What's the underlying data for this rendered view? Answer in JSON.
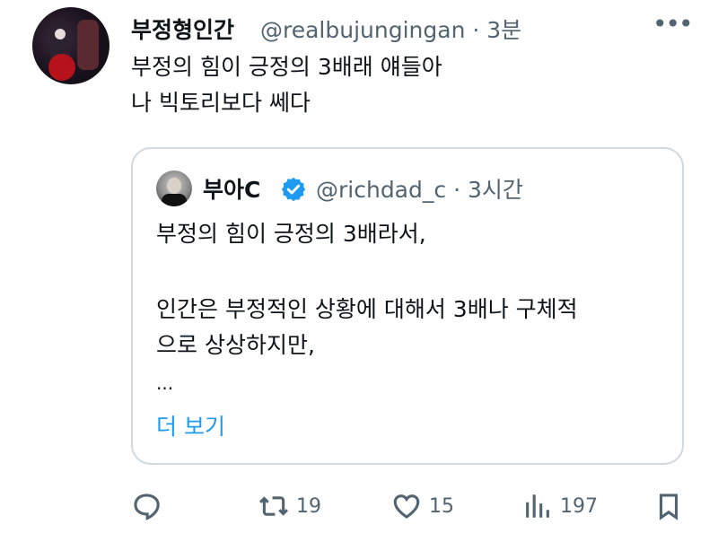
{
  "tweet": {
    "author_name": "부정형인간",
    "handle_time": "@realbujungingan · 3분",
    "more_label": "•••",
    "lines": [
      "부정의 힘이 긍정의 3배래 얘들아",
      "나 빅토리보다 쎄다"
    ]
  },
  "quote": {
    "author_name": "부아C",
    "handle_time": "@richdad_c · 3시간",
    "lines": [
      "부정의 힘이 긍정의 3배라서,",
      "",
      "인간은 부정적인 상황에 대해서 3배나 구체적",
      "으로 상상하지만,",
      "..."
    ],
    "show_more": "더 보기",
    "verified_color": "#1d9bf0"
  },
  "actions": {
    "reply_icon": "reply-icon",
    "retweet_count": "19",
    "like_count": "15",
    "views_count": "197",
    "bookmark_icon": "bookmark-icon"
  }
}
